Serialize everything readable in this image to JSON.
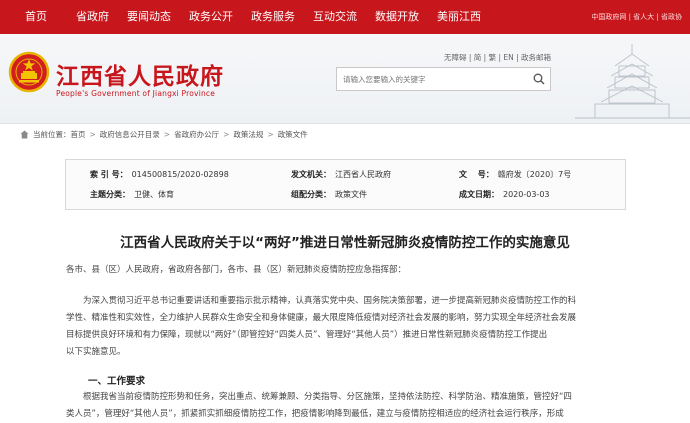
{
  "nav": {
    "items": [
      "首页",
      "省政府",
      "要闻动态",
      "政务公开",
      "政务服务",
      "互动交流",
      "数据开放",
      "美丽江西"
    ],
    "right_text": "中国政府网 | 省人大 | 省政协"
  },
  "header": {
    "title": "江西省人民政府",
    "subtitle": "People's Government of Jiangxi Province",
    "quicklinks": "无障碍 | 简 | 繁 | EN | 政务邮箱",
    "search_placeholder": "请输入您要输入的关键字"
  },
  "breadcrumb": {
    "label": "当前位置：",
    "items": [
      "首页",
      "政府信息公开目录",
      "省政府办公厅",
      "政策法规",
      "政策文件"
    ]
  },
  "meta": {
    "index_label": "索 引 号：",
    "index_value": "014500815/2020-02898",
    "issuer_label": "发文机关：",
    "issuer_value": "江西省人民政府",
    "docno_label": "文　 号：",
    "docno_value": "赣府发〔2020〕7号",
    "topic_label": "主题分类：",
    "topic_value": "卫健、体育",
    "genre_label": "组配分类：",
    "genre_value": "政策文件",
    "date_label": "成文日期：",
    "date_value": "2020-03-03"
  },
  "article": {
    "title": "江西省人民政府关于以“两好”推进日常性新冠肺炎疫情防控工作的实施意见",
    "salutation": "各市、县（区）人民政府，省政府各部门，各市、县（区）新冠肺炎疫情防控应急指挥部：",
    "para1_line1": "为深入贯彻习近平总书记重要讲话和重要指示批示精神，认真落实党中央、国务院决策部署，进一步提高新冠肺炎疫情防控工作的科",
    "para1_line2": "学性、精准性和实效性，全力维护人民群众生命安全和身体健康，最大限度降低疫情对经济社会发展的影响，努力实现全年经济社会发展",
    "para1_line3": "目标提供良好环境和有力保障，现就以“两好”（即管控好“四类人员”、管理好“其他人员”）推进日常性新冠肺炎疫情防控工作提出",
    "para1_line4": "以下实施意见。",
    "section1": "一、工作要求",
    "para2_line1": "根据我省当前疫情防控形势和任务，突出重点、统筹兼顾、分类指导、分区施策，坚持依法防控、科学防治、精准施策，管控好“四",
    "para2_line2": "类人员”，管理好“其他人员”，抓紧抓实抓细疫情防控工作，把疫情影响降到最低，建立与疫情防控相适应的经济社会运行秩序，形成"
  }
}
